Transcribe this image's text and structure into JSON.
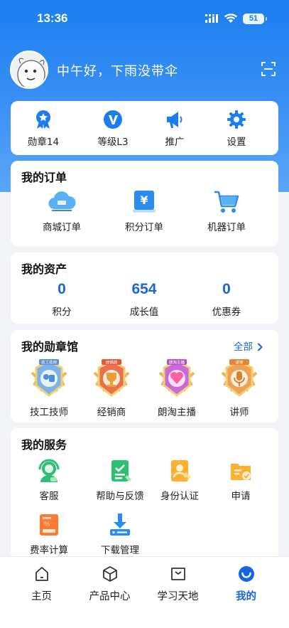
{
  "status_bar": {
    "time": "13:36",
    "battery": "51"
  },
  "header": {
    "greeting": "中午好，下雨没带伞"
  },
  "quick_menu": [
    {
      "label": "勋章14",
      "icon": "medal-icon"
    },
    {
      "label": "等级L3",
      "icon": "level-v-icon"
    },
    {
      "label": "推广",
      "icon": "megaphone-icon"
    },
    {
      "label": "设置",
      "icon": "gear-icon"
    }
  ],
  "orders": {
    "title": "我的订单",
    "items": [
      {
        "label": "商城订单",
        "icon": "cloud-cart-icon"
      },
      {
        "label": "积分订单",
        "icon": "yen-card-icon"
      },
      {
        "label": "机器订单",
        "icon": "shopping-cart-icon"
      }
    ]
  },
  "assets": {
    "title": "我的资产",
    "items": [
      {
        "value": "0",
        "label": "积分"
      },
      {
        "value": "654",
        "label": "成长值"
      },
      {
        "value": "0",
        "label": "优惠券"
      }
    ]
  },
  "badges": {
    "title": "我的勋章馆",
    "all_label": "全部",
    "items": [
      {
        "label": "技工技师",
        "ribbon": "技工技师",
        "color": "#7fb3e8"
      },
      {
        "label": "经销商",
        "ribbon": "经销商",
        "color": "#e8704a"
      },
      {
        "label": "朗淘主播",
        "ribbon": "朗淘主播",
        "color": "#c86ad8"
      },
      {
        "label": "讲师",
        "ribbon": "讲师",
        "color": "#f0a055"
      }
    ]
  },
  "services": {
    "title": "我的服务",
    "items": [
      {
        "label": "客服",
        "icon": "headset-icon"
      },
      {
        "label": "帮助与反馈",
        "icon": "feedback-icon"
      },
      {
        "label": "身份认证",
        "icon": "id-verify-icon"
      },
      {
        "label": "申请",
        "icon": "apply-folder-icon"
      },
      {
        "label": "费率计算",
        "icon": "calculator-icon"
      },
      {
        "label": "下载管理",
        "icon": "download-icon"
      }
    ]
  },
  "tabbar": [
    {
      "label": "主页",
      "icon": "home-icon"
    },
    {
      "label": "产品中心",
      "icon": "box-icon"
    },
    {
      "label": "学习天地",
      "icon": "book-icon"
    },
    {
      "label": "我的",
      "icon": "smile-icon",
      "active": true
    }
  ],
  "colors": {
    "primary": "#1b7df0",
    "accent_text": "#1a66d6",
    "service_green": "#2fbf72",
    "service_orange": "#ffb02e"
  }
}
